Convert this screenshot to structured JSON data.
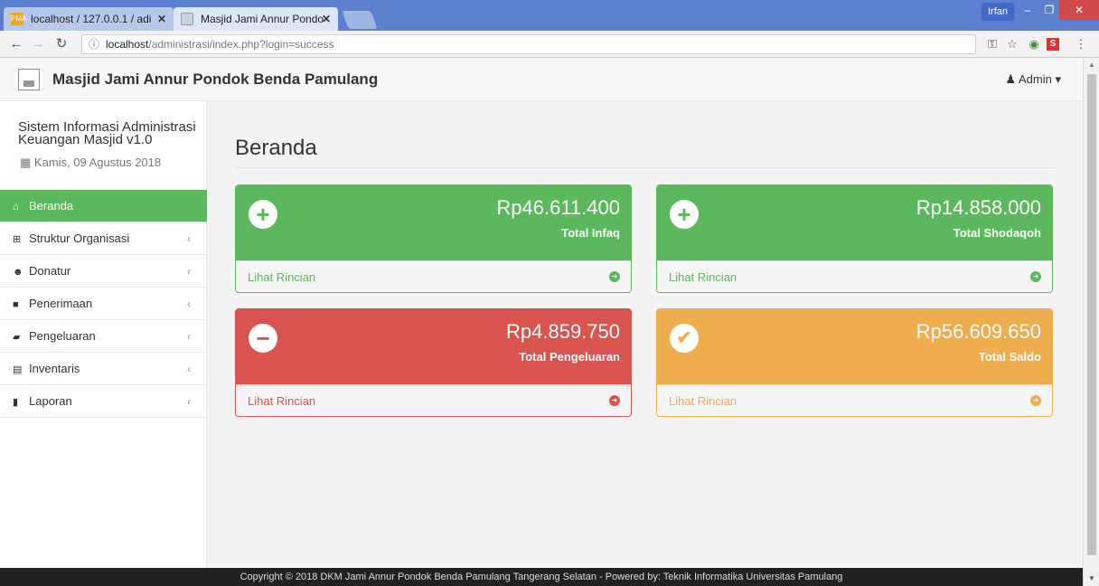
{
  "browser": {
    "tabs": [
      {
        "label": "localhost / 127.0.0.1 / adi",
        "favicon": "PMA"
      },
      {
        "label": "Masjid Jami Annur Pondo",
        "favicon": ""
      }
    ],
    "profile": "Irfan",
    "url_host": "localhost",
    "url_path": "/administrasi/index.php?login=success"
  },
  "app": {
    "brand": "Masjid Jami Annur Pondok Benda Pamulang",
    "user_menu": "Admin"
  },
  "sidebar": {
    "system_name": "Sistem Informasi Administrasi Keuangan Masjid v1.0",
    "date": "Kamis, 09 Agustus 2018",
    "items": [
      {
        "label": "Beranda",
        "icon": "home-icon"
      },
      {
        "label": "Struktur Organisasi",
        "icon": "sitemap-icon"
      },
      {
        "label": "Donatur",
        "icon": "users-icon"
      },
      {
        "label": "Penerimaan",
        "icon": "folder-icon"
      },
      {
        "label": "Pengeluaran",
        "icon": "folder-open-icon"
      },
      {
        "label": "Inventaris",
        "icon": "archive-icon"
      },
      {
        "label": "Laporan",
        "icon": "book-icon"
      }
    ]
  },
  "main": {
    "title": "Beranda",
    "cards": [
      {
        "amount": "Rp46.611.400",
        "label": "Total Infaq",
        "link": "Lihat Rincian",
        "icon": "plus-circle-icon",
        "color": "#5cb85c"
      },
      {
        "amount": "Rp14.858.000",
        "label": "Total Shodaqoh",
        "link": "Lihat Rincian",
        "icon": "plus-circle-icon",
        "color": "#5cb85c"
      },
      {
        "amount": "Rp4.859.750",
        "label": "Total Pengeluaran",
        "link": "Lihat Rincian",
        "icon": "minus-circle-icon",
        "color": "#d9534f"
      },
      {
        "amount": "Rp56.609.650",
        "label": "Total Saldo",
        "link": "Lihat Rincian",
        "icon": "check-circle-icon",
        "color": "#f0ad4e"
      }
    ]
  },
  "footer": "Copyright © 2018 DKM Jami Annur Pondok Benda Pamulang Tangerang Selatan - Powered by: Teknik Informatika Universitas Pamulang"
}
